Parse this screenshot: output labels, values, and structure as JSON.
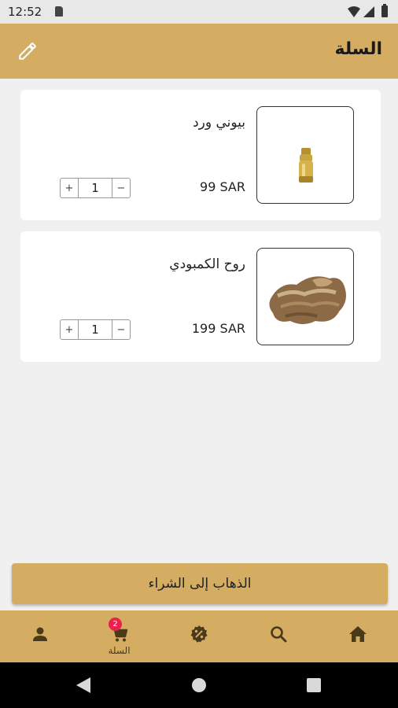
{
  "status_bar": {
    "time": "12:52"
  },
  "header": {
    "title": "السلة"
  },
  "cart": {
    "items": [
      {
        "name": "بيوني ورد",
        "price": "99 SAR",
        "quantity": "1",
        "plus": "+",
        "minus": "−"
      },
      {
        "name": "روح الكمبودي",
        "price": "199 SAR",
        "quantity": "1",
        "plus": "+",
        "minus": "−"
      }
    ]
  },
  "checkout": {
    "label": "الذهاب إلى الشراء"
  },
  "nav": {
    "cart_label": "السلة",
    "cart_badge": "2",
    "items": [
      "profile-icon",
      "cart-icon",
      "offers-icon",
      "search-icon",
      "home-icon"
    ]
  },
  "colors": {
    "accent": "#d4ad62",
    "badge": "#e8224b",
    "background": "#f0f0f0"
  }
}
